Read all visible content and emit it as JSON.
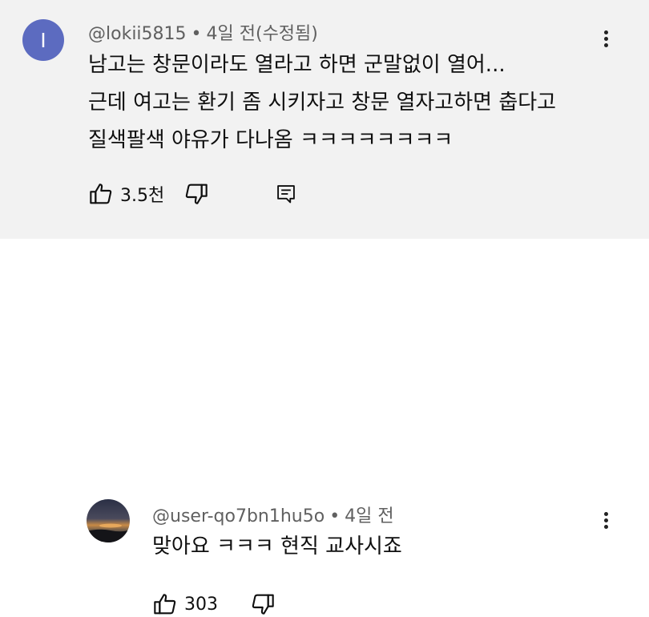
{
  "comments": [
    {
      "avatar_letter": "I",
      "avatar_color": "#5c6bc0",
      "handle": "@lokii5815",
      "separator": "•",
      "time": "4일 전(수정됨)",
      "lines": [
        "남고는 창문이라도 열라고 하면 군말없이 열어...",
        "근데 여고는 환기 좀 시키자고 창문 열자고하면 춥다고",
        "질색팔색 야유가 다나옴 ㅋㅋㅋㅋㅋㅋㅋㅋ"
      ],
      "like_count": "3.5천",
      "icons": {
        "like": "thumbs-up-icon",
        "dislike": "thumbs-down-icon",
        "reply": "reply-icon",
        "menu": "more-vert-icon"
      }
    },
    {
      "handle": "@user-qo7bn1hu5o",
      "separator": "•",
      "time": "4일 전",
      "lines": [
        "맞아요 ㅋㅋㅋ 현직 교사시죠"
      ],
      "like_count": "303",
      "icons": {
        "like": "thumbs-up-icon",
        "dislike": "thumbs-down-icon",
        "menu": "more-vert-icon"
      }
    }
  ],
  "colors": {
    "highlight_bg": "#f2f2f2",
    "meta_text": "#606060",
    "text": "#0f0f0f"
  }
}
